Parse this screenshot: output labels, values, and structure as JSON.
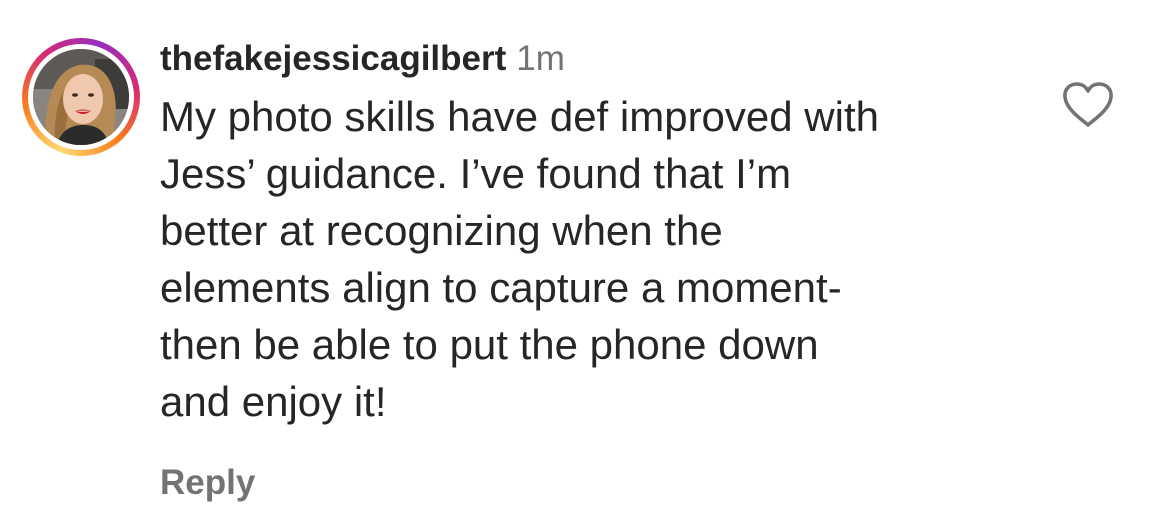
{
  "comment": {
    "username": "thefakejessicagilbert",
    "timestamp": "1m",
    "lines": [
      "My photo skills have def improved with",
      "Jess’ guidance. I’ve found that I’m",
      "better at recognizing when the",
      "elements align to capture a moment-",
      "then be able to put the phone down",
      "and enjoy it!"
    ],
    "reply_label": "Reply",
    "avatar_icon": "profile-photo",
    "like_icon": "heart-outline-icon"
  },
  "colors": {
    "text": "#262626",
    "secondary": "#737373",
    "story_ring": [
      "#feda75",
      "#fa7e1e",
      "#d62976",
      "#962fbf"
    ]
  }
}
